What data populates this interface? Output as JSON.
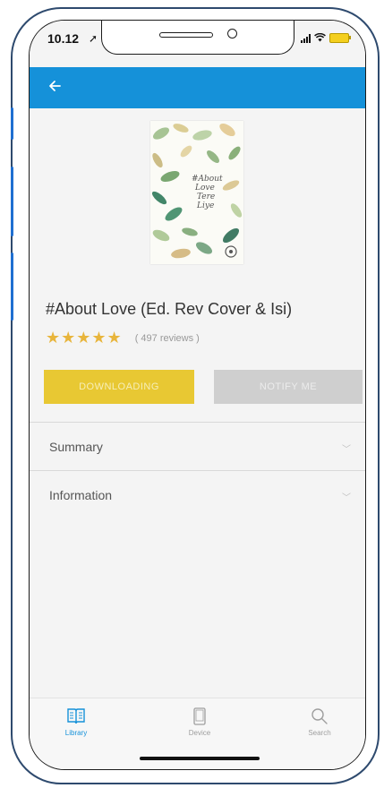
{
  "status_bar": {
    "time": "10.12",
    "location_icon": "location-arrow-icon",
    "signal_icon": "cellular-signal-icon",
    "wifi_icon": "wifi-icon",
    "battery_icon": "battery-icon",
    "battery_color": "#f4cf1e"
  },
  "app_bar": {
    "back_icon": "back-arrow-icon",
    "color": "#1591d9"
  },
  "book": {
    "cover_lines": [
      "#About",
      "Love",
      "Tere",
      "Liye"
    ],
    "title": "#About Love (Ed. Rev Cover & Isi)",
    "rating": 5,
    "stars": "★★★★★",
    "reviews": "( 497 reviews )",
    "star_color": "#e8b53c"
  },
  "actions": {
    "download_label": "DOWNLOADING",
    "download_color": "#e8c833",
    "notify_label": "NOTIFY ME",
    "notify_color": "#cfcfcf"
  },
  "sections": [
    {
      "label": "Summary",
      "icon": "chevron-down-icon"
    },
    {
      "label": "Information",
      "icon": "chevron-down-icon"
    }
  ],
  "bottom_nav": {
    "items": [
      {
        "label": "Library",
        "icon": "book-open-icon",
        "active": true,
        "color": "#1591d9"
      },
      {
        "label": "Device",
        "icon": "phone-device-icon",
        "active": false,
        "color": "#9e9e9e"
      },
      {
        "label": "Search",
        "icon": "search-icon",
        "active": false,
        "color": "#9e9e9e"
      }
    ]
  }
}
